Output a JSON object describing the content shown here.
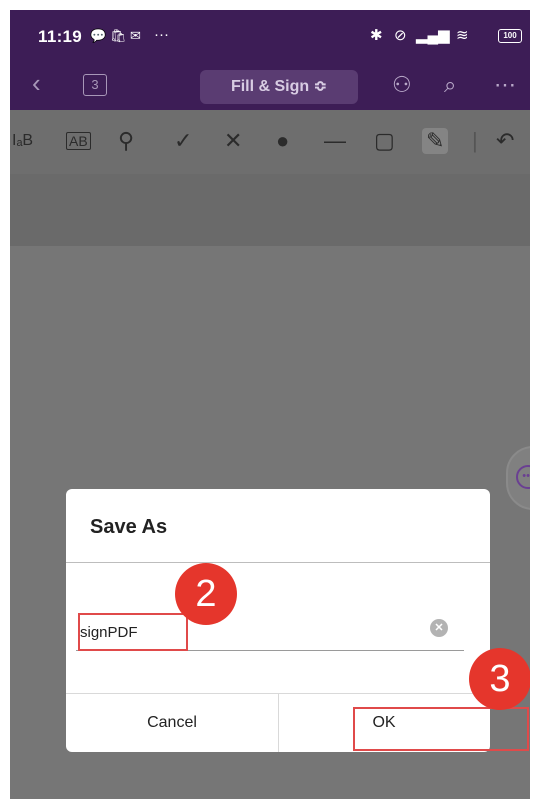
{
  "status_bar": {
    "time": "11:19",
    "notification_icons": [
      "chat-icon",
      "shop-icon",
      "mail-icon"
    ],
    "more": "···",
    "battery": "100"
  },
  "nav": {
    "page_count": "3",
    "mode_label": "Fill & Sign ≎"
  },
  "toolbar": {
    "text_tool_1": "IₐB",
    "text_tool_2": "AB"
  },
  "dialog": {
    "title": "Save As",
    "filename_value": "signPDF",
    "cancel_label": "Cancel",
    "ok_label": "OK"
  },
  "annotations": {
    "step_2": "2",
    "step_3": "3"
  },
  "colors": {
    "header": "#3d1d56",
    "overlay": "#767676",
    "marker": "#e5362c"
  }
}
